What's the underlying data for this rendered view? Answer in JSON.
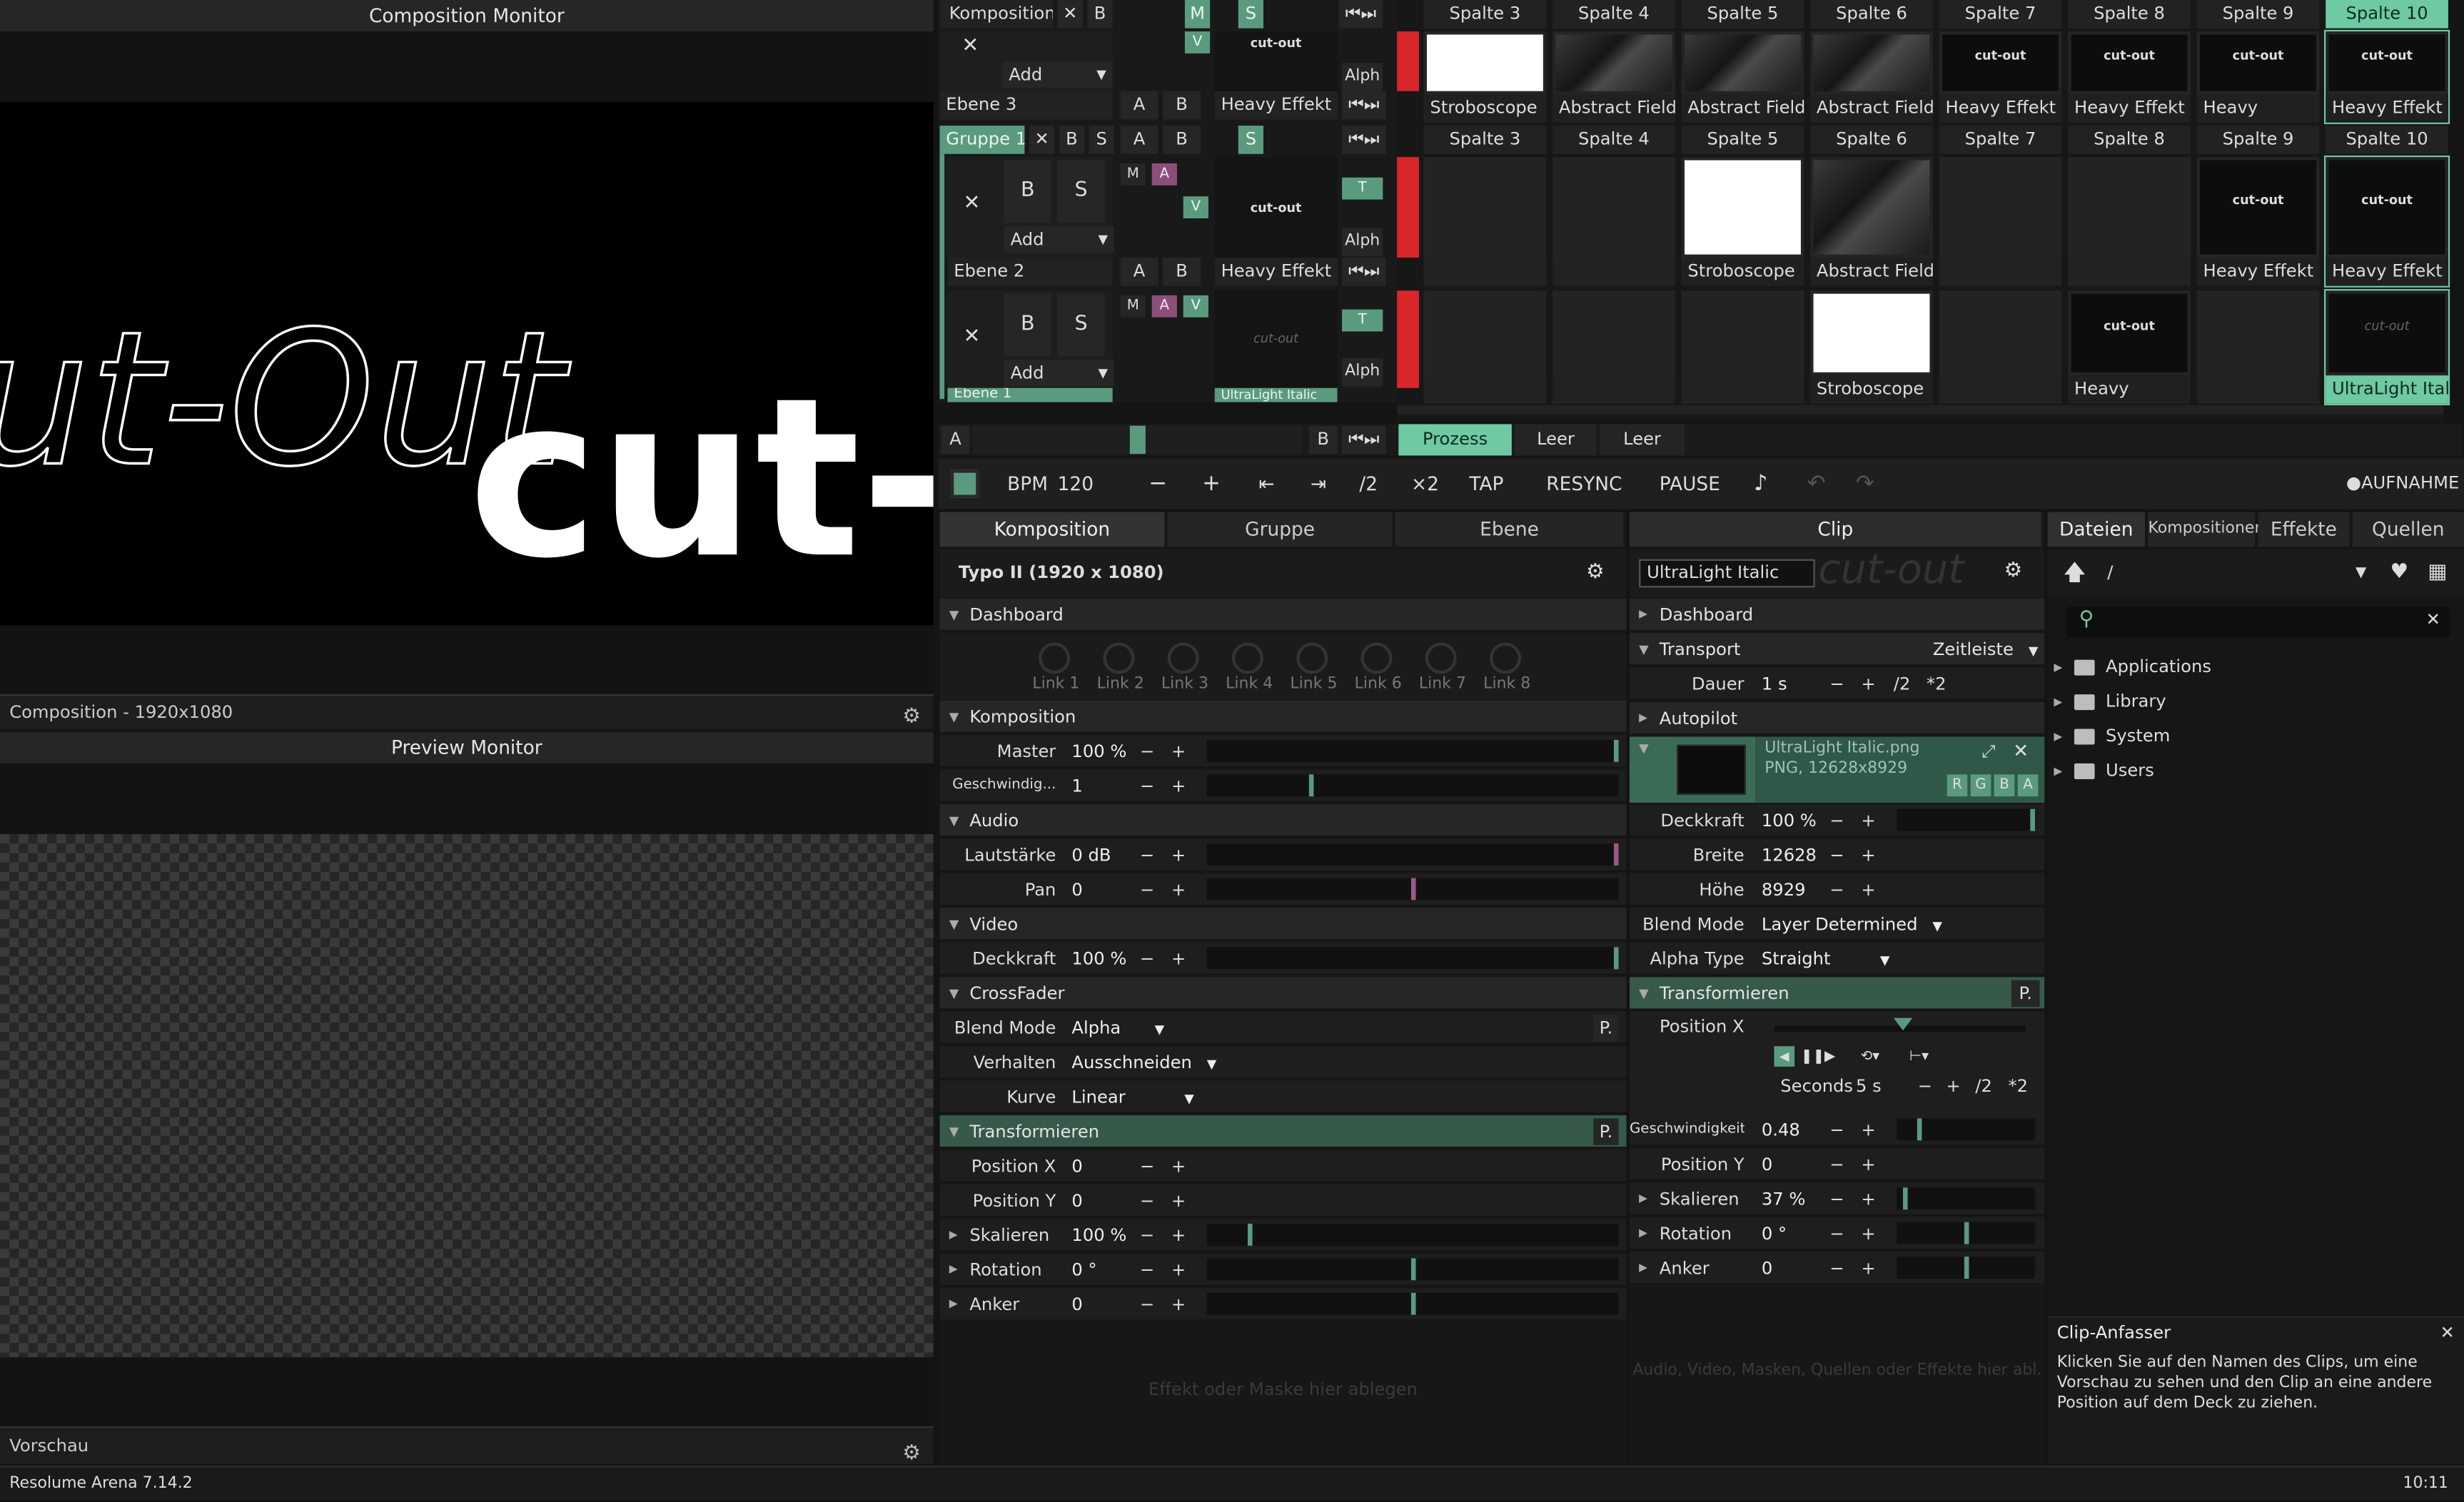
{
  "app": {
    "status": "Resolume Arena 7.14.2",
    "clock": "10:11"
  },
  "monitors": {
    "composition_title": "Composition Monitor",
    "composition_footer": "Composition - 1920x1080",
    "preview_title": "Preview Monitor",
    "preview_footer": "Vorschau",
    "canvas_text_outline": "ut-Out",
    "canvas_text_bold": "cut-"
  },
  "deck": {
    "comp_label": "Komposition",
    "x_label": "✕",
    "b_label": "B",
    "m_label": "M",
    "s_label": "S",
    "a_label": "A",
    "v_label": "V",
    "t_label": "T",
    "alph_label": "Alph",
    "add_label": "Add",
    "layer3": "Ebene 3",
    "layer2": "Ebene 2",
    "layer1": "Ebene 1",
    "group": "Gruppe 1",
    "columns": [
      "Spalte 3",
      "Spalte 4",
      "Spalte 5",
      "Spalte 6",
      "Spalte 7",
      "Spalte 8",
      "Spalte 9",
      "Spalte 10"
    ],
    "thumb_cutout": "cut-out",
    "row1_captions": [
      "Stroboscope",
      "Abstract Field",
      "Abstract Field",
      "Abstract Field",
      "Heavy Effekt",
      "Heavy Effekt",
      "Heavy",
      "Heavy Effekt"
    ],
    "row2_captions": [
      "",
      "",
      "Stroboscope",
      "Abstract Field",
      "",
      "",
      "Heavy Effekt",
      "Heavy Effekt"
    ],
    "row3_captions": [
      "",
      "",
      "",
      "Stroboscope",
      "",
      "Heavy",
      "",
      "UltraLight Italic"
    ],
    "layer_clip_caption": "Heavy Effekt",
    "layer1_clip_caption": "UltraLight Italic",
    "decks": [
      "Prozess",
      "Leer",
      "Leer"
    ]
  },
  "transport": {
    "bpm_label": "BPM",
    "bpm": "120",
    "minus": "−",
    "plus": "+",
    "half": "/2",
    "double": "×2",
    "tap": "TAP",
    "resync": "RESYNC",
    "pause": "PAUSE",
    "record": "AUFNAHME"
  },
  "left_panel": {
    "tabs": [
      "Komposition",
      "Gruppe",
      "Ebene"
    ],
    "title": "Typo II (1920 x 1080)",
    "dashboard": "Dashboard",
    "links": [
      "Link 1",
      "Link 2",
      "Link 3",
      "Link 4",
      "Link 5",
      "Link 6",
      "Link 7",
      "Link 8"
    ],
    "komposition": "Komposition",
    "master_label": "Master",
    "master_value": "100 %",
    "master_level": 1.0,
    "speed_label": "Geschwindig...",
    "speed_value": "1",
    "speed_level": 0.25,
    "audio": "Audio",
    "volume_label": "Lautstärke",
    "volume_value": "0 dB",
    "volume_level": 1.0,
    "pan_label": "Pan",
    "pan_value": "0",
    "pan_level": 0.5,
    "video": "Video",
    "opacity_label": "Deckkraft",
    "opacity_value": "100 %",
    "opacity_level": 1.0,
    "crossfader": "CrossFader",
    "blend_label": "Blend Mode",
    "blend_value": "Alpha",
    "behave_label": "Verhalten",
    "behave_value": "Ausschneiden",
    "curve_label": "Kurve",
    "curve_value": "Linear",
    "transform": "Transformieren",
    "posx_label": "Position X",
    "posx_value": "0",
    "posy_label": "Position Y",
    "posy_value": "0",
    "scale_label": "Skalieren",
    "scale_value": "100 %",
    "scale_level": 0.1,
    "rot_label": "Rotation",
    "rot_value": "0 °",
    "rot_level": 0.5,
    "anchor_label": "Anker",
    "anchor_value": "0",
    "anchor_level": 0.5,
    "drop_hint": "Effekt oder Maske hier ablegen",
    "p_label": "P."
  },
  "clip_panel": {
    "tab": "Clip",
    "name": "UltraLight Italic",
    "dashboard": "Dashboard",
    "transport": "Transport",
    "timeline": "Zeitleiste",
    "duration_label": "Dauer",
    "duration_value": "1 s",
    "half": "/2",
    "double": "*2",
    "autopilot": "Autopilot",
    "file_name": "UltraLight Italic.png",
    "file_info": "PNG, 12628x8929",
    "rgba": [
      "R",
      "G",
      "B",
      "A"
    ],
    "opacity_label": "Deckkraft",
    "opacity_value": "100 %",
    "opacity_level": 1.0,
    "width_label": "Breite",
    "width_value": "12628",
    "height_label": "Höhe",
    "height_value": "8929",
    "blend_label": "Blend Mode",
    "blend_value": "Layer Determined",
    "alpha_label": "Alpha Type",
    "alpha_value": "Straight",
    "transform": "Transformieren",
    "posx_label": "Position X",
    "seconds_label": "Seconds",
    "seconds_value": "5 s",
    "speed_label": "Geschwindigkeit",
    "speed_value": "0.48",
    "speed_level": 0.15,
    "posy_label": "Position Y",
    "posy_value": "0",
    "scale_label": "Skalieren",
    "scale_value": "37 %",
    "scale_level": 0.05,
    "rot_label": "Rotation",
    "rot_value": "0 °",
    "rot_level": 0.5,
    "anchor_label": "Anker",
    "anchor_value": "0",
    "anchor_level": 0.5,
    "drop_hint": "Audio, Video, Masken, Quellen oder Effekte hier abl...",
    "p_label": "P."
  },
  "browser": {
    "tabs": [
      "Dateien",
      "Kompositionen",
      "Effekte",
      "Quellen"
    ],
    "path": "/",
    "folders": [
      "Applications",
      "Library",
      "System",
      "Users"
    ],
    "help_title": "Clip-Anfasser",
    "help_text": "Klicken Sie auf den Namen des Clips, um eine Vorschau zu sehen und den Clip an eine andere Position auf dem Deck zu ziehen."
  }
}
